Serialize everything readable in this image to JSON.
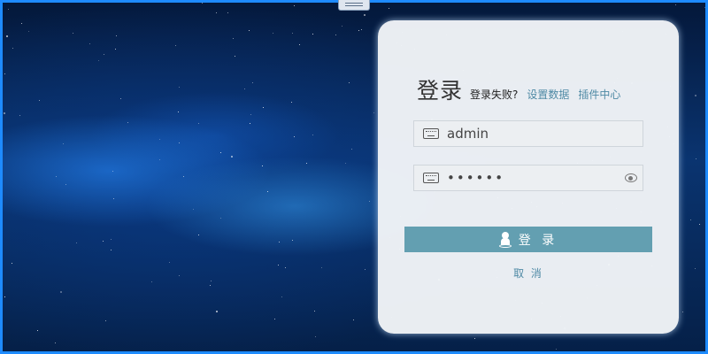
{
  "login": {
    "title": "登录",
    "fail_text": "登录失败?",
    "settings_link": "设置数据",
    "plugin_link": "插件中心",
    "username_value": "admin",
    "password_value": "••••••",
    "submit_label": "登 录",
    "cancel_label": "取 消"
  },
  "colors": {
    "border_accent": "#1e8bff",
    "button": "#639fb1",
    "link": "#4f8aa5"
  },
  "icons": [
    "drag-handle-icon",
    "keyboard-icon",
    "eye-icon",
    "person-icon"
  ]
}
